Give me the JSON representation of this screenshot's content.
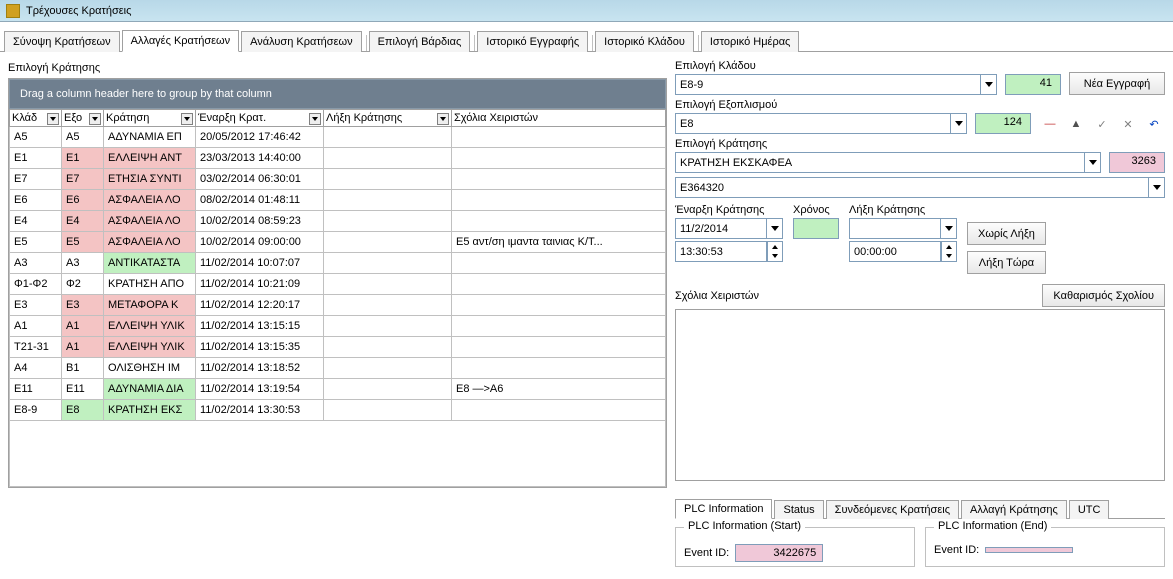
{
  "window": {
    "title": "Τρέχουσες Κρατήσεις"
  },
  "main_tabs": [
    "Σύνοψη Κρατήσεων",
    "Αλλαγές Κρατήσεων",
    "Ανάλυση Κρατήσεων",
    "Επιλογή Βάρδιας",
    "Ιστορικό Εγγραφής",
    "Ιστορικό Κλάδου",
    "Ιστορικό Ημέρας"
  ],
  "main_tab_active": 1,
  "left": {
    "selection_label": "Επιλογή Κράτησης",
    "group_hint": "Drag a column header here to group by that column",
    "columns": [
      "Κλάδ",
      "Εξο",
      "Κράτηση",
      "Έναρξη Κρατ.",
      "Λήξη Κράτησης",
      "Σχόλια Χειριστών"
    ],
    "rows": [
      {
        "c0": "A5",
        "c1": "A5",
        "c2": "ΑΔΥΝΑΜΙΑ ΕΠ",
        "c3": "20/05/2012 17:46:42",
        "c4": "",
        "c5": "",
        "h1": "",
        "h2": ""
      },
      {
        "c0": "E1",
        "c1": "E1",
        "c2": "ΕΛΛΕΙΨΗ ΑΝΤ",
        "c3": "23/03/2013 14:40:00",
        "c4": "",
        "c5": "",
        "h1": "pink",
        "h2": "pink"
      },
      {
        "c0": "E7",
        "c1": "E7",
        "c2": "ΕΤΗΣΙΑ ΣΥΝΤΙ",
        "c3": "03/02/2014 06:30:01",
        "c4": "",
        "c5": "",
        "h1": "pink",
        "h2": "pink"
      },
      {
        "c0": "E6",
        "c1": "E6",
        "c2": "ΑΣΦΑΛΕΙΑ ΛΟ",
        "c3": "08/02/2014 01:48:11",
        "c4": "",
        "c5": "",
        "h1": "pink",
        "h2": "pink"
      },
      {
        "c0": "E4",
        "c1": "E4",
        "c2": "ΑΣΦΑΛΕΙΑ ΛΟ",
        "c3": "10/02/2014 08:59:23",
        "c4": "",
        "c5": "",
        "h1": "pink",
        "h2": "pink"
      },
      {
        "c0": "E5",
        "c1": "E5",
        "c2": "ΑΣΦΑΛΕΙΑ ΛΟ",
        "c3": "10/02/2014 09:00:00",
        "c4": "",
        "c5": "E5 αντ/ση ιμαντα ταινιας Κ/Τ...",
        "h1": "pink",
        "h2": "pink"
      },
      {
        "c0": "A3",
        "c1": "A3",
        "c2": "ΑΝΤΙΚΑΤΑΣΤΑ",
        "c3": "11/02/2014 10:07:07",
        "c4": "",
        "c5": "",
        "h1": "",
        "h2": "green"
      },
      {
        "c0": "Φ1-Φ2",
        "c1": "Φ2",
        "c2": "ΚΡΑΤΗΣΗ ΑΠΟ",
        "c3": "11/02/2014 10:21:09",
        "c4": "",
        "c5": "",
        "h1": "",
        "h2": ""
      },
      {
        "c0": "E3",
        "c1": "E3",
        "c2": "ΜΕΤΑΦΟΡΑ Κ",
        "c3": "11/02/2014 12:20:17",
        "c4": "",
        "c5": "",
        "h1": "pink",
        "h2": "pink"
      },
      {
        "c0": "A1",
        "c1": "A1",
        "c2": "ΕΛΛΕΙΨΗ ΥΛΙΚ",
        "c3": "11/02/2014 13:15:15",
        "c4": "",
        "c5": "",
        "h1": "pink",
        "h2": "pink"
      },
      {
        "c0": "T21-31",
        "c1": "A1",
        "c2": "ΕΛΛΕΙΨΗ ΥΛΙΚ",
        "c3": "11/02/2014 13:15:35",
        "c4": "",
        "c5": "",
        "h1": "pink",
        "h2": "pink"
      },
      {
        "c0": "A4",
        "c1": "B1",
        "c2": "ΟΛΙΣΘΗΣΗ ΙΜ",
        "c3": "11/02/2014 13:18:52",
        "c4": "",
        "c5": "",
        "h1": "",
        "h2": ""
      },
      {
        "c0": "E11",
        "c1": "E11",
        "c2": "ΑΔΥΝΑΜΙΑ ΔΙΑ",
        "c3": "11/02/2014 13:19:54",
        "c4": "",
        "c5": "E8 —>A6",
        "h1": "",
        "h2": "green"
      },
      {
        "c0": "E8-9",
        "c1": "E8",
        "c2": "ΚΡΑΤΗΣΗ ΕΚΣ",
        "c3": "11/02/2014 13:30:53",
        "c4": "",
        "c5": "",
        "h1": "green",
        "h2": "green"
      }
    ]
  },
  "right": {
    "branch_label": "Επιλογή Κλάδου",
    "branch_value": "E8-9",
    "branch_count": "41",
    "new_record": "Νέα Εγγραφή",
    "equip_label": "Επιλογή Εξοπλισμού",
    "equip_value": "E8",
    "equip_count": "124",
    "hold_label": "Επιλογή Κράτησης",
    "hold_value": "ΚΡΑΤΗΣΗ ΕΚΣΚΑΦΕΑ",
    "hold_code": "3263",
    "hold_id": "E364320",
    "start_label": "Έναρξη Κράτησης",
    "start_date": "11/2/2014",
    "start_time": "13:30:53",
    "time_label": "Χρόνος",
    "time_value": "",
    "end_label": "Λήξη Κράτησης",
    "end_date": "",
    "end_time": "00:00:00",
    "no_end_btn": "Χωρίς Λήξη",
    "end_now_btn": "Λήξη Τώρα",
    "comments_label": "Σχόλια Χειριστών",
    "clear_comments_btn": "Καθαρισμός Σχολίου",
    "sub_tabs": [
      "PLC Information",
      "Status",
      "Συνδεόμενες Κρατήσεις",
      "Αλλαγή Κράτησης",
      "UTC"
    ],
    "sub_tab_active": 0,
    "plc_start_legend": "PLC Information (Start)",
    "plc_end_legend": "PLC Information (End)",
    "event_id_label": "Event ID:",
    "event_id_start": "3422675",
    "event_id_end": ""
  }
}
